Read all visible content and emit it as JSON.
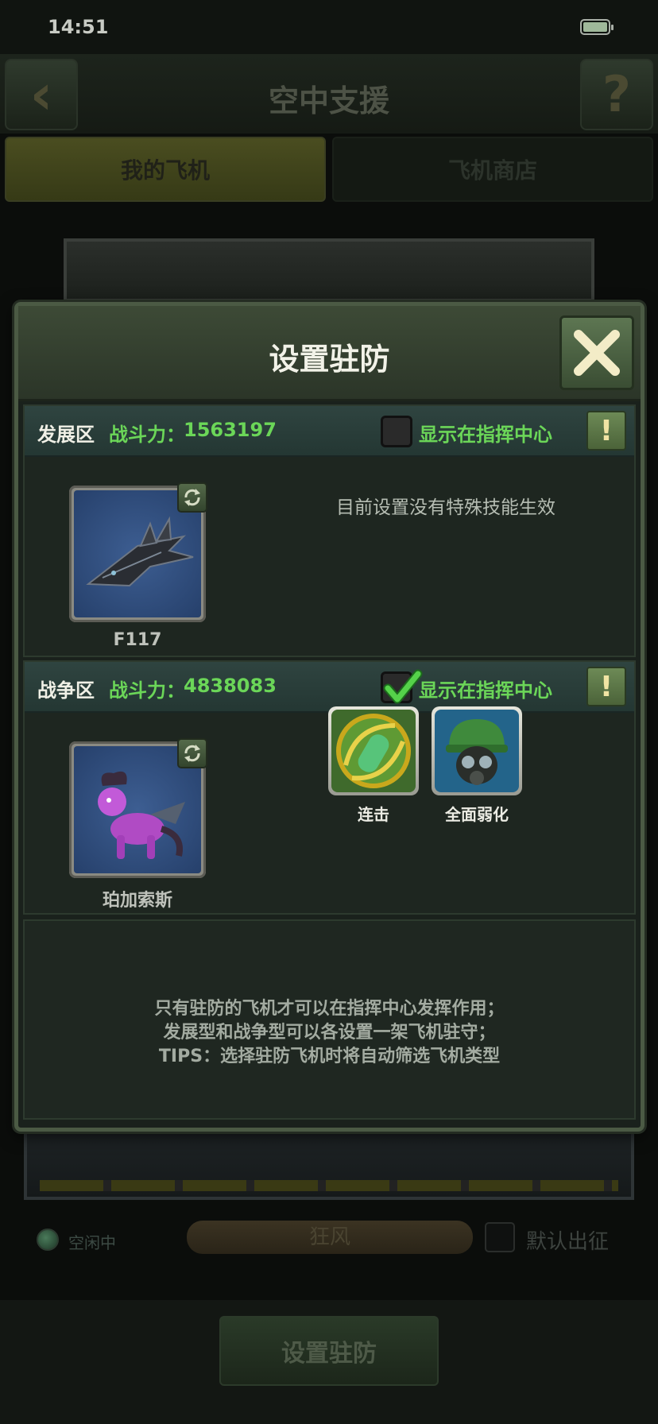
{
  "status_bar": {
    "time": "14:51"
  },
  "header": {
    "title": "空中支援",
    "back_icon": "chevron-left-icon",
    "help_icon": "question-mark-icon"
  },
  "tabs": [
    {
      "label": "我的飞机",
      "active": true
    },
    {
      "label": "飞机商店",
      "active": false
    }
  ],
  "background": {
    "idle_status": "空闲中",
    "plane_name": "狂风",
    "default_sortie_label": "默认出征",
    "bottom_button": "设置驻防"
  },
  "modal": {
    "title": "设置驻防",
    "close_icon": "close-x-icon",
    "development_zone": {
      "name": "发展区",
      "power_label": "战斗力：",
      "power_value": "1563197",
      "show_label": "显示在指挥中心",
      "show_checked": false,
      "plane_name": "F117",
      "skill_message": "目前设置没有特殊技能生效"
    },
    "war_zone": {
      "name": "战争区",
      "power_label": "战斗力：",
      "power_value": "4838083",
      "show_label": "显示在指挥中心",
      "show_checked": true,
      "plane_name": "珀加索斯",
      "skills": [
        {
          "label": "连击",
          "icon": "missile-combo-icon"
        },
        {
          "label": "全面弱化",
          "icon": "gas-mask-soldier-icon"
        }
      ]
    },
    "notes": [
      "只有驻防的飞机才可以在指挥中心发挥作用；",
      "发展型和战争型可以各设置一架飞机驻守；",
      "TIPS：选择驻防飞机时将自动筛选飞机类型"
    ]
  },
  "colors": {
    "accent_green": "#6bd658",
    "modal_border": "#4b5a44",
    "zone_header": "#2f4440"
  }
}
